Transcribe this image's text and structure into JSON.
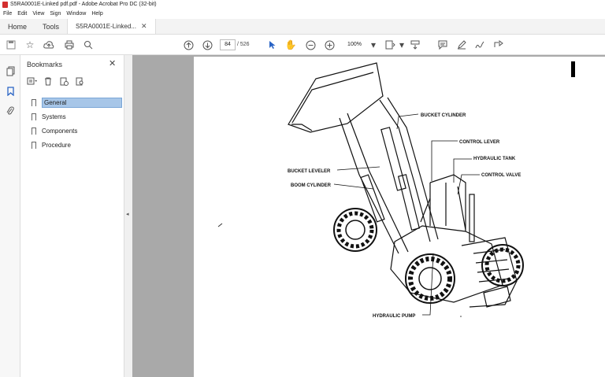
{
  "window": {
    "title": "S5RA0001E-Linked pdf.pdf - Adobe Acrobat Pro DC (32-bit)"
  },
  "menu": [
    "File",
    "Edit",
    "View",
    "Sign",
    "Window",
    "Help"
  ],
  "tabs": {
    "home": "Home",
    "tools": "Tools",
    "document": "S5RA0001E-Linked..."
  },
  "toolbar": {
    "current_page": "84",
    "total_pages": "/ 526",
    "zoom": "100%"
  },
  "bookmarks": {
    "title": "Bookmarks",
    "items": [
      {
        "label": "General",
        "selected": true
      },
      {
        "label": "Systems",
        "selected": false
      },
      {
        "label": "Components",
        "selected": false
      },
      {
        "label": "Procedure",
        "selected": false
      }
    ]
  },
  "figure": {
    "callouts": {
      "bucket_cylinder": "BUCKET CYLINDER",
      "control_lever": "CONTROL LEVER",
      "hydraulic_tank": "HYDRAULIC TANK",
      "control_valve": "CONTROL VALVE",
      "bucket_leveler": "BUCKET LEVELER",
      "boom_cylinder": "BOOM CYLINDER",
      "hydraulic_pump": "HYDRAULIC PUMP"
    }
  }
}
